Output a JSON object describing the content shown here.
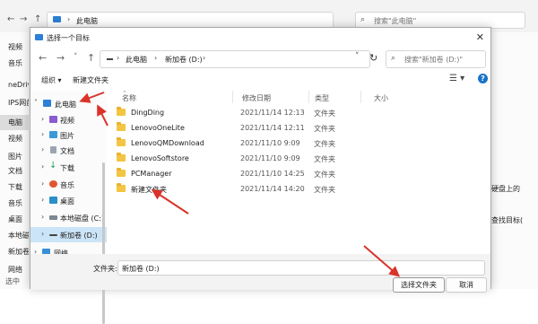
{
  "background": {
    "title": "此电脑",
    "search_placeholder": "搜索\"此电脑\"",
    "sidebar": [
      "视频",
      "音乐",
      "neDriv",
      "IPS网盘",
      "电脑",
      "视频",
      "图片",
      "文档",
      "下载",
      "音乐",
      "桌面",
      "本地磁",
      "新加卷",
      "网络"
    ],
    "right_text": [
      "硬盘上的",
      "查找目标("
    ],
    "bottom_left": "选中"
  },
  "dialog": {
    "title": "选择一个目标",
    "close": "✕",
    "address": {
      "crumbs": [
        "此电脑",
        "新加卷 (D:)"
      ]
    },
    "search_placeholder": "搜索\"新加卷 (D:)\"",
    "toolbar": {
      "organize": "组织 ▾",
      "new_folder": "新建文件夹"
    },
    "columns": [
      "名称",
      "修改日期",
      "类型",
      "大小"
    ],
    "tree": [
      {
        "label": "此电脑",
        "icon": "pc-icon",
        "expanded": true
      },
      {
        "label": "视频",
        "icon": "video-icon"
      },
      {
        "label": "图片",
        "icon": "picture-icon"
      },
      {
        "label": "文档",
        "icon": "document-icon"
      },
      {
        "label": "下载",
        "icon": "download-icon"
      },
      {
        "label": "音乐",
        "icon": "music-icon"
      },
      {
        "label": "桌面",
        "icon": "desktop-icon"
      },
      {
        "label": "本地磁盘 (C:)",
        "icon": "drive-icon"
      },
      {
        "label": "新加卷 (D:)",
        "icon": "drive-icon",
        "selected": true
      },
      {
        "label": "网络",
        "icon": "network-icon"
      }
    ],
    "files": [
      {
        "name": "DingDing",
        "date": "2021/11/14 12:13",
        "type": "文件夹"
      },
      {
        "name": "LenovoOneLite",
        "date": "2021/11/14 12:11",
        "type": "文件夹"
      },
      {
        "name": "LenovoQMDownload",
        "date": "2021/11/10 9:09",
        "type": "文件夹"
      },
      {
        "name": "LenovoSoftstore",
        "date": "2021/11/10 9:09",
        "type": "文件夹"
      },
      {
        "name": "PCManager",
        "date": "2021/11/10 14:25",
        "type": "文件夹"
      },
      {
        "name": "新建文件夹",
        "date": "2021/11/14 14:20",
        "type": "文件夹"
      }
    ],
    "footer": {
      "folder_label": "文件夹:",
      "folder_value": "新加卷 (D:)",
      "select_button": "选择文件夹",
      "cancel_button": "取消"
    }
  },
  "colors": {
    "accent": "#1a73c8",
    "arrow": "#d9332a",
    "folder": "#f4c542",
    "selected": "#cce4f7"
  }
}
